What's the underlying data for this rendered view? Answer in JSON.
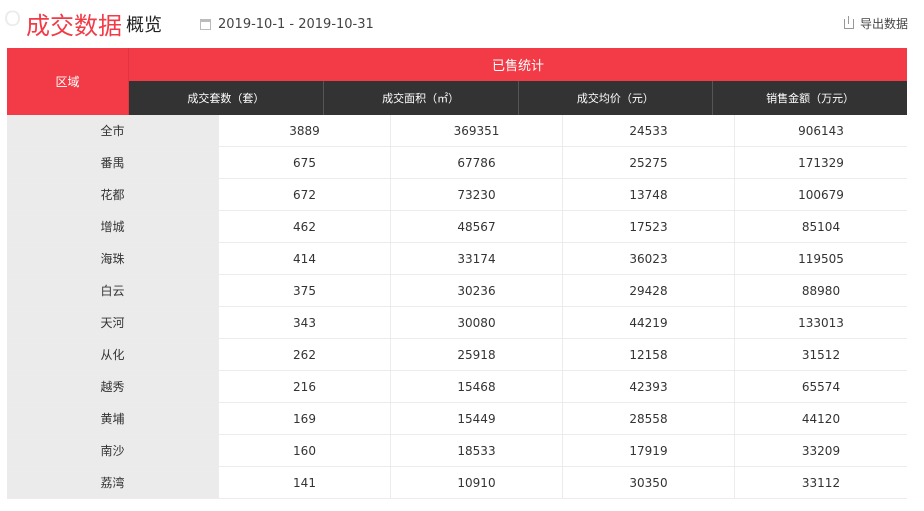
{
  "header": {
    "watermark": "O",
    "title": "成交数据",
    "subtitle": "概览",
    "date_range": "2019-10-1 - 2019-10-31",
    "export_label": "导出数据"
  },
  "table": {
    "region_header": "区域",
    "group_header": "已售统计",
    "columns": [
      "成交套数（套）",
      "成交面积（㎡）",
      "成交均价（元）",
      "销售金额（万元）"
    ],
    "rows": [
      [
        "全市",
        "3889",
        "369351",
        "24533",
        "906143"
      ],
      [
        "番禺",
        "675",
        "67786",
        "25275",
        "171329"
      ],
      [
        "花都",
        "672",
        "73230",
        "13748",
        "100679"
      ],
      [
        "增城",
        "462",
        "48567",
        "17523",
        "85104"
      ],
      [
        "海珠",
        "414",
        "33174",
        "36023",
        "119505"
      ],
      [
        "白云",
        "375",
        "30236",
        "29428",
        "88980"
      ],
      [
        "天河",
        "343",
        "30080",
        "44219",
        "133013"
      ],
      [
        "从化",
        "262",
        "25918",
        "12158",
        "31512"
      ],
      [
        "越秀",
        "216",
        "15468",
        "42393",
        "65574"
      ],
      [
        "黄埔",
        "169",
        "15449",
        "28558",
        "44120"
      ],
      [
        "南沙",
        "160",
        "18533",
        "17919",
        "33209"
      ],
      [
        "荔湾",
        "141",
        "10910",
        "30350",
        "33112"
      ]
    ]
  },
  "colors": {
    "accent": "#f23b46",
    "header_dark": "#333333",
    "region_cell": "#ebebeb"
  },
  "icons": {
    "date": "calendar-icon",
    "export": "export-icon"
  }
}
